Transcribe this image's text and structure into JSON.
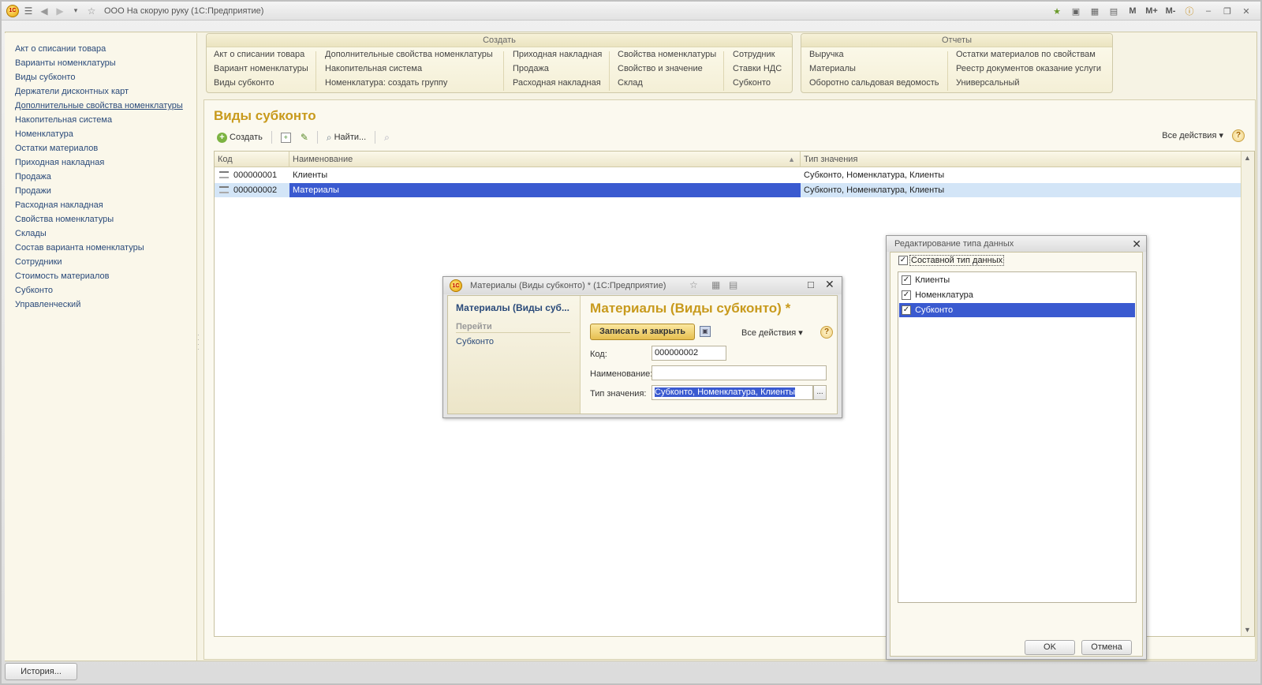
{
  "window": {
    "title": "ООО На скорую руку  (1С:Предприятие)",
    "logo": "1С",
    "title_right_letters": [
      "M",
      "M+",
      "M-"
    ]
  },
  "sidebar": {
    "items": [
      {
        "label": "Акт о списании товара"
      },
      {
        "label": "Варианты номенклатуры"
      },
      {
        "label": "Виды субконто"
      },
      {
        "label": "Держатели дисконтных карт"
      },
      {
        "label": "Дополнительные свойства номенклатуры"
      },
      {
        "label": "Накопительная система"
      },
      {
        "label": "Номенклатура"
      },
      {
        "label": "Остатки материалов"
      },
      {
        "label": "Приходная накладная"
      },
      {
        "label": "Продажа"
      },
      {
        "label": "Продажи"
      },
      {
        "label": "Расходная накладная"
      },
      {
        "label": "Свойства номенклатуры"
      },
      {
        "label": "Склады"
      },
      {
        "label": "Состав варианта номенклатуры"
      },
      {
        "label": "Сотрудники"
      },
      {
        "label": "Стоимость материалов"
      },
      {
        "label": "Субконто"
      },
      {
        "label": "Управленческий"
      }
    ]
  },
  "create_panel": {
    "title": "Создать",
    "columns": [
      [
        "Акт о списании товара",
        "Вариант номенклатуры",
        "Виды субконто"
      ],
      [
        "Дополнительные свойства номенклатуры",
        "Накопительная система",
        "Номенклатура: создать группу"
      ],
      [
        "Приходная накладная",
        "Продажа",
        "Расходная накладная"
      ],
      [
        "Свойства номенклатуры",
        "Свойство и значение",
        "Склад"
      ],
      [
        "Сотрудник",
        "Ставки НДС",
        "Субконто"
      ]
    ]
  },
  "reports_panel": {
    "title": "Отчеты",
    "columns": [
      [
        "Выручка",
        "Материалы",
        "Оборотно сальдовая ведомость"
      ],
      [
        "Остатки материалов по свойствам",
        "Реестр документов оказание услуги",
        "Универсальный"
      ]
    ]
  },
  "list_form": {
    "title": "Виды субконто",
    "toolbar": {
      "create": "Создать",
      "find": "Найти...",
      "all_actions": "Все действия ▾",
      "help": "?"
    },
    "columns": [
      "Код",
      "Наименование",
      "Тип значения"
    ],
    "rows": [
      {
        "code": "000000001",
        "name": "Клиенты",
        "type": "Субконто, Номенклатура, Клиенты"
      },
      {
        "code": "000000002",
        "name": "Материалы",
        "type": "Субконто, Номенклатура, Клиенты"
      }
    ],
    "selected_row_index": 1
  },
  "history_button": "История...",
  "item_dialog": {
    "window_title": "Материалы (Виды субконто) * (1С:Предприятие)",
    "nav_header": "Материалы (Виды суб...",
    "nav_group": "Перейти",
    "nav_link": "Субконто",
    "form_title": "Материалы (Виды субконто) *",
    "save_close": "Записать и закрыть",
    "all_actions": "Все действия ▾",
    "help": "?",
    "fields": {
      "code_label": "Код:",
      "code_value": "000000002",
      "name_label": "Наименование:",
      "name_value": "",
      "type_label": "Тип значения:",
      "type_value": "Субконто, Номенклатура, Клиенты",
      "ellipsis": "..."
    }
  },
  "type_dialog": {
    "title": "Редактирование типа данных",
    "composite_label": "Составной тип данных",
    "composite_checked": true,
    "items": [
      {
        "label": "Клиенты",
        "checked": true
      },
      {
        "label": "Номенклатура",
        "checked": true
      },
      {
        "label": "Субконто",
        "checked": true
      }
    ],
    "selected_item_index": 2,
    "ok": "OK",
    "cancel": "Отмена"
  },
  "colors": {
    "accent_title": "#c89a1c",
    "selection": "#3a5ad0",
    "row_highlight": "#d3e5f7",
    "link": "#2a4a7a"
  }
}
